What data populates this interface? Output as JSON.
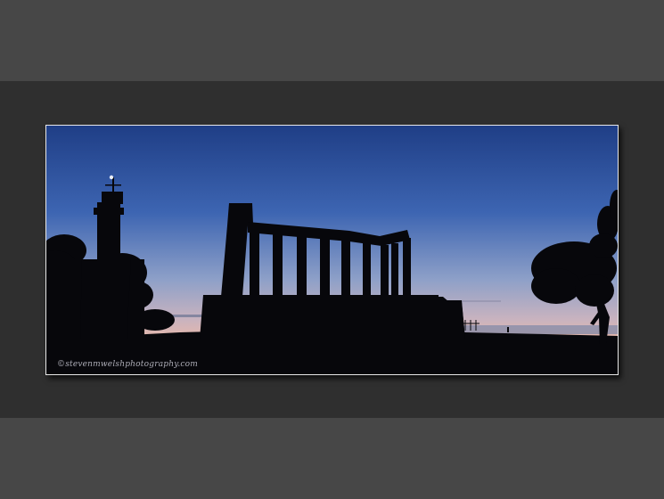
{
  "photo": {
    "subject": "National Monument on Calton Hill silhouetted at dusk",
    "watermark": "©stevenmwelshphotography.com",
    "colors": {
      "outer_background": "#474747",
      "inner_band": "#2f2f2f",
      "frame_border": "#e8e8e8",
      "sky_top": "#1f3e86",
      "sky_horizon": "#e3b7ad",
      "silhouette": "#07070b"
    }
  }
}
